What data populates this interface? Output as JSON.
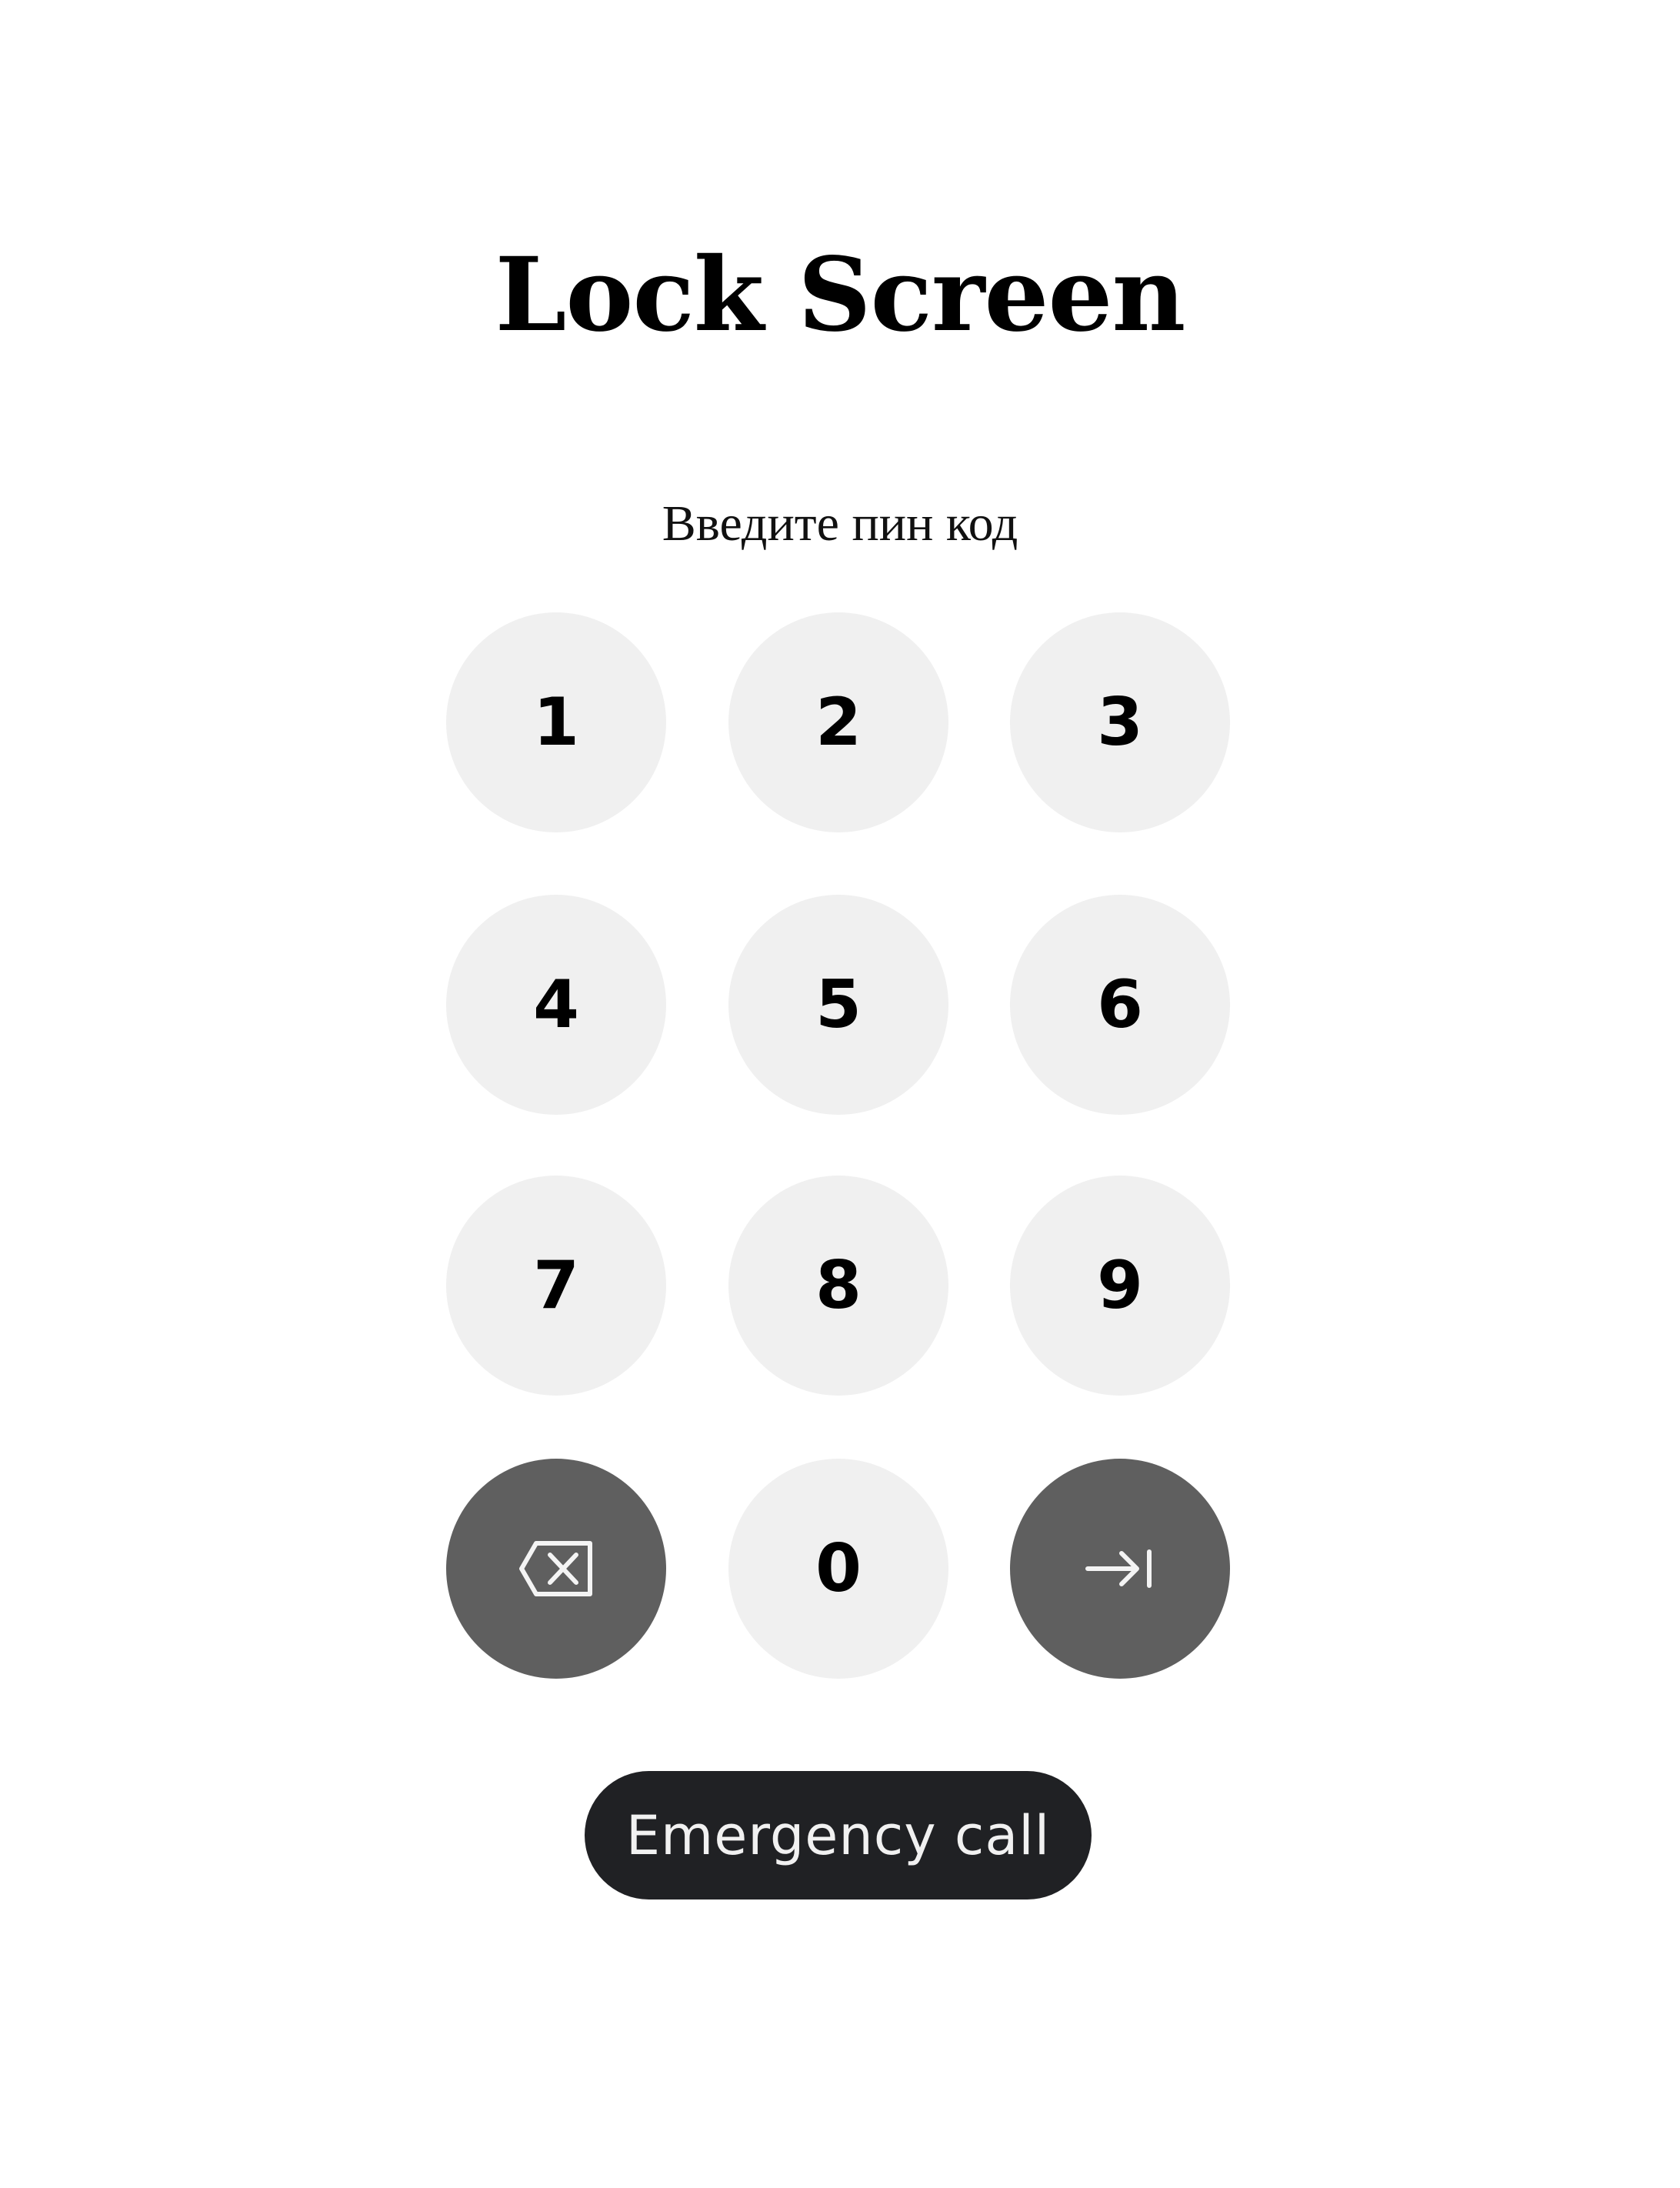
{
  "page": {
    "title": "Lock Screen",
    "prompt": "Введите пин код"
  },
  "keypad": {
    "keys": [
      {
        "label": "1",
        "type": "digit"
      },
      {
        "label": "2",
        "type": "digit"
      },
      {
        "label": "3",
        "type": "digit"
      },
      {
        "label": "4",
        "type": "digit"
      },
      {
        "label": "5",
        "type": "digit"
      },
      {
        "label": "6",
        "type": "digit"
      },
      {
        "label": "7",
        "type": "digit"
      },
      {
        "label": "8",
        "type": "digit"
      },
      {
        "label": "9",
        "type": "digit"
      },
      {
        "label": "",
        "type": "backspace",
        "icon": "backspace-icon"
      },
      {
        "label": "0",
        "type": "digit"
      },
      {
        "label": "",
        "type": "submit",
        "icon": "arrow-right-to-bar-icon"
      }
    ]
  },
  "emergency": {
    "label": "Emergency call"
  },
  "colors": {
    "key_light": "#f0f0f0",
    "key_dark": "#5f5f5f",
    "emergency_bg": "#202124"
  }
}
